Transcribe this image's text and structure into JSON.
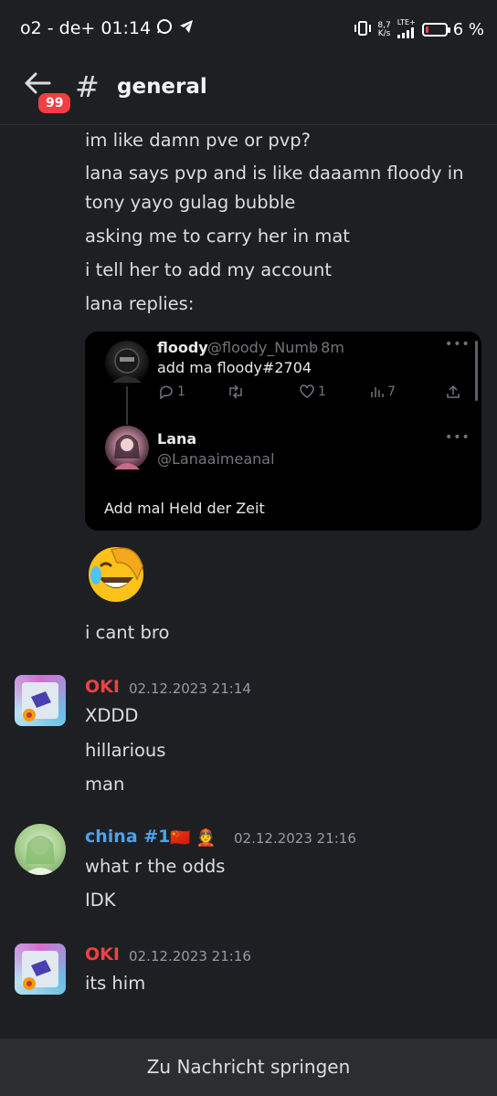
{
  "status_bar": {
    "carrier": "o2 - de+",
    "time": "01:14",
    "net_speed_top": "8,7",
    "net_speed_bottom": "K/s",
    "network_type": "LTE+",
    "battery": "6 %"
  },
  "header": {
    "badge_count": "99",
    "hash": "#",
    "channel_name": "general"
  },
  "messages_top": [
    "im like damn pve or pvp?",
    "lana says pvp and is like daaamn floody in",
    "tony yayo gulag bubble",
    "asking me to carry her in mat",
    "i tell her to add my account",
    "lana replies:"
  ],
  "embed": {
    "tweet1": {
      "name": "floody",
      "handle": "@floody_Numb",
      "time": "· 8m",
      "text": "add ma floody#2704",
      "replies": "1",
      "likes": "1",
      "views": "7"
    },
    "tweet2": {
      "name": "Lana",
      "handle": "@Lanaaimeanal",
      "text": "Add mal Held der Zeit"
    }
  },
  "after_embed": "i cant bro",
  "groups": [
    {
      "author": "OKI",
      "author_color": "#ed4245",
      "timestamp": "02.12.2023 21:14",
      "lines": [
        "XDDD",
        "hillarious",
        "man"
      ]
    },
    {
      "author": "china #1",
      "author_color": "#4aa3f0",
      "author_emojis": "🇨🇳 👲",
      "timestamp": "02.12.2023 21:16",
      "lines": [
        "what r the odds",
        "IDK"
      ]
    },
    {
      "author": "OKI",
      "author_color": "#ed4245",
      "timestamp": "02.12.2023 21:16",
      "lines": [
        "its him"
      ]
    }
  ],
  "jump_bar": "Zu Nachricht springen"
}
